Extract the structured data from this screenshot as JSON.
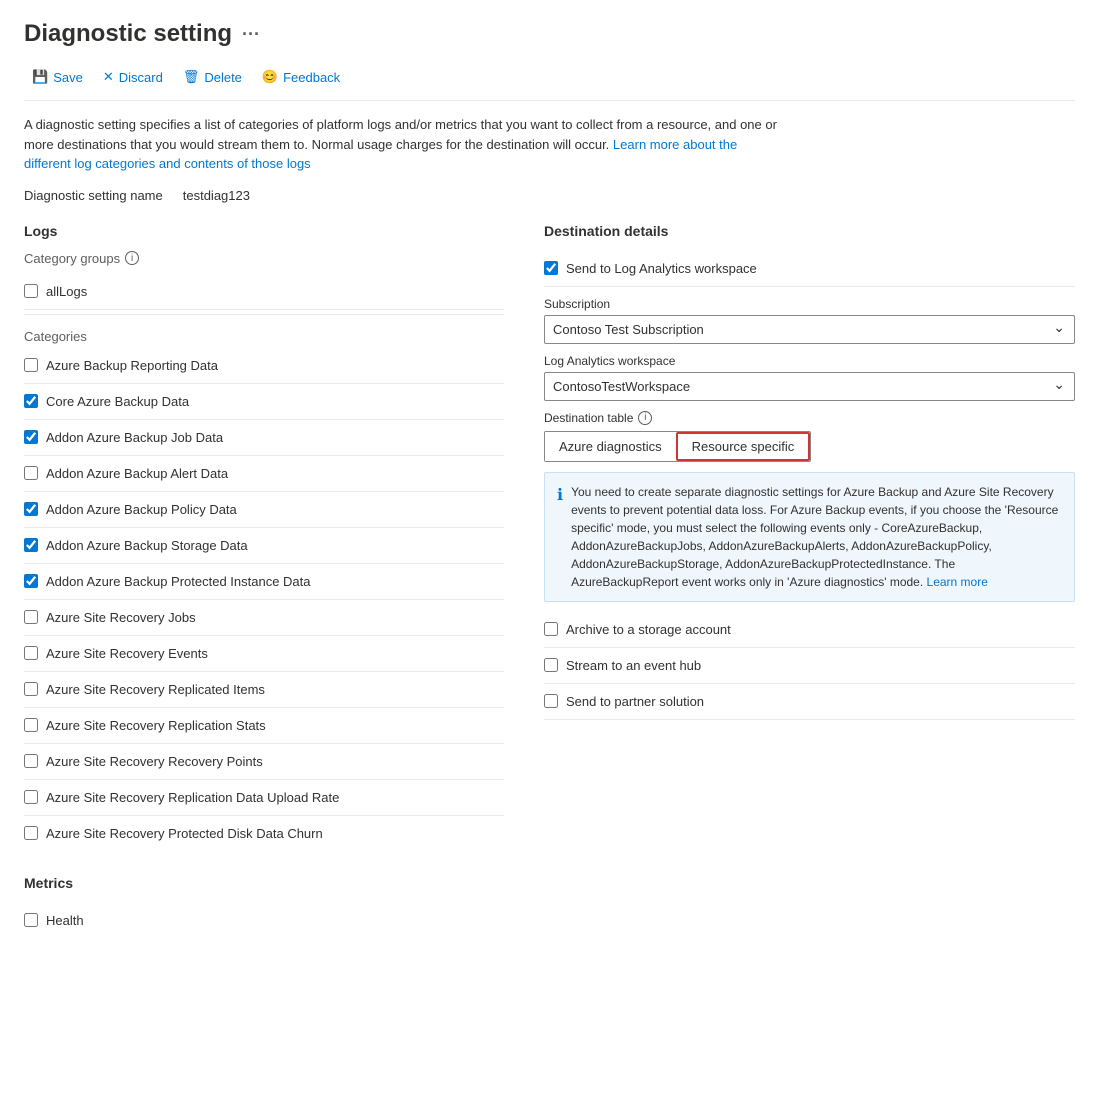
{
  "page": {
    "title": "Diagnostic setting",
    "title_dots": "···"
  },
  "toolbar": {
    "save_label": "Save",
    "discard_label": "Discard",
    "delete_label": "Delete",
    "feedback_label": "Feedback"
  },
  "description": {
    "text1": "A diagnostic setting specifies a list of categories of platform logs and/or metrics that you want to collect from a resource, and one or more destinations that you would stream them to. Normal usage charges for the destination will occur.",
    "link_text": "Learn more about the different log categories and contents of those logs"
  },
  "setting_name": {
    "label": "Diagnostic setting name",
    "value": "testdiag123"
  },
  "logs": {
    "section_title": "Logs",
    "category_groups_label": "Category groups",
    "all_logs_label": "allLogs",
    "all_logs_checked": false,
    "categories_label": "Categories",
    "categories": [
      {
        "label": "Azure Backup Reporting Data",
        "checked": false
      },
      {
        "label": "Core Azure Backup Data",
        "checked": true
      },
      {
        "label": "Addon Azure Backup Job Data",
        "checked": true
      },
      {
        "label": "Addon Azure Backup Alert Data",
        "checked": false
      },
      {
        "label": "Addon Azure Backup Policy Data",
        "checked": true
      },
      {
        "label": "Addon Azure Backup Storage Data",
        "checked": true
      },
      {
        "label": "Addon Azure Backup Protected Instance Data",
        "checked": true
      },
      {
        "label": "Azure Site Recovery Jobs",
        "checked": false
      },
      {
        "label": "Azure Site Recovery Events",
        "checked": false
      },
      {
        "label": "Azure Site Recovery Replicated Items",
        "checked": false
      },
      {
        "label": "Azure Site Recovery Replication Stats",
        "checked": false
      },
      {
        "label": "Azure Site Recovery Recovery Points",
        "checked": false
      },
      {
        "label": "Azure Site Recovery Replication Data Upload Rate",
        "checked": false
      },
      {
        "label": "Azure Site Recovery Protected Disk Data Churn",
        "checked": false
      }
    ]
  },
  "metrics": {
    "section_title": "Metrics",
    "items": [
      {
        "label": "Health",
        "checked": false
      }
    ]
  },
  "destination": {
    "section_title": "Destination details",
    "options": [
      {
        "label": "Send to Log Analytics workspace",
        "checked": true
      },
      {
        "label": "Archive to a storage account",
        "checked": false
      },
      {
        "label": "Stream to an event hub",
        "checked": false
      },
      {
        "label": "Send to partner solution",
        "checked": false
      }
    ],
    "subscription_label": "Subscription",
    "subscription_value": "Contoso Test Subscription",
    "workspace_label": "Log Analytics workspace",
    "workspace_value": "ContosoTestWorkspace",
    "dest_table_label": "Destination table",
    "dest_table_options": [
      {
        "label": "Azure diagnostics",
        "active": false
      },
      {
        "label": "Resource specific",
        "active": true
      }
    ],
    "info_box_text": "You need to create separate diagnostic settings for Azure Backup and Azure Site Recovery events to prevent potential data loss. For Azure Backup events, if you choose the 'Resource specific' mode, you must select the following events only - CoreAzureBackup, AddonAzureBackupJobs, AddonAzureBackupAlerts, AddonAzureBackupPolicy, AddonAzureBackupStorage, AddonAzureBackupProtectedInstance. The AzureBackupReport event works only in 'Azure diagnostics' mode.",
    "learn_more_link": "Learn more"
  }
}
